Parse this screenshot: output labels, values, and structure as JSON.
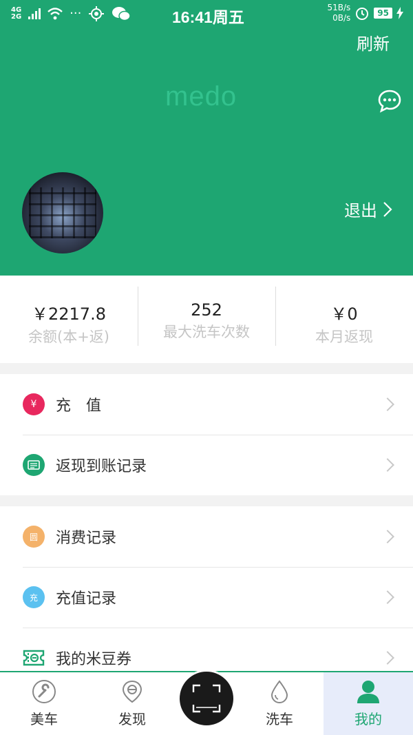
{
  "status_bar": {
    "network_1": "4G",
    "network_2": "2G",
    "dots": "···",
    "time": "16:41周五",
    "speed_up": "51B/s",
    "speed_down": "0B/s",
    "battery": "95"
  },
  "header": {
    "refresh_label": "刷新",
    "logo_text": "medo",
    "logout_label": "退出"
  },
  "stats": [
    {
      "value": "￥2217.8",
      "label": "余额(本+返)"
    },
    {
      "value": "252",
      "label": "最大洗车次数"
    },
    {
      "value": "￥0",
      "label": "本月返现"
    }
  ],
  "menu": {
    "group1": [
      {
        "label": "充　值",
        "icon": "yuan-icon",
        "icon_text": "¥",
        "color": "#e8285e"
      },
      {
        "label": "返现到账记录",
        "icon": "list-icon",
        "color": "#1ea672"
      }
    ],
    "group2": [
      {
        "label": "消费记录",
        "icon": "receipt-icon",
        "icon_text": "圆",
        "color": "#f4b26a"
      },
      {
        "label": "充值记录",
        "icon": "recharge-icon",
        "icon_text": "充",
        "color": "#5bc1f0"
      },
      {
        "label": "我的米豆券",
        "icon": "coupon-icon",
        "color": "#1ea672"
      }
    ]
  },
  "bottom_nav": [
    {
      "label": "美车",
      "icon": "wrench-icon"
    },
    {
      "label": "发现",
      "icon": "discover-icon"
    },
    {
      "label": "洗车",
      "icon": "water-drop-icon"
    },
    {
      "label": "我的",
      "icon": "person-icon",
      "active": true
    }
  ],
  "colors": {
    "brand_green": "#1ea672",
    "recharge_pink": "#e8285e"
  }
}
